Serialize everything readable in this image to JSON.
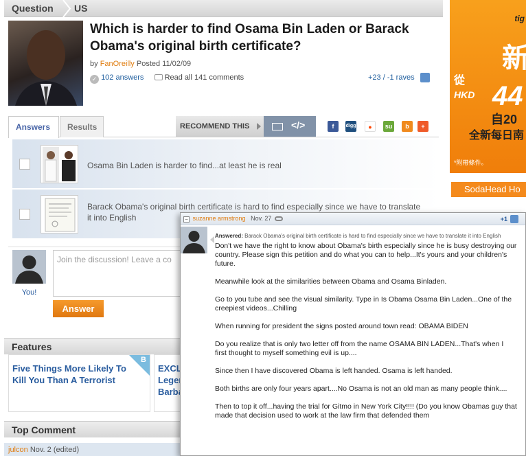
{
  "breadcrumb": {
    "section": "Question",
    "category": "US"
  },
  "question": {
    "title": "Which is harder to find Osama Bin Laden or Barack Obama's original birth certificate?",
    "by_label": "by",
    "author": "FanOreilly",
    "posted": "Posted 11/02/09",
    "answers_count": "102 answers",
    "read_all": "Read all 141 comments",
    "raves": "+23 / -1 raves"
  },
  "tabs": [
    {
      "label": "Answers",
      "active": true
    },
    {
      "label": "Results",
      "active": false
    }
  ],
  "recommend": {
    "label": "RECOMMEND THIS",
    "icons": [
      "facebook-icon",
      "digg-icon",
      "reddit-icon",
      "stumbleupon-icon",
      "blogger-icon",
      "plus-icon"
    ]
  },
  "answers": [
    {
      "text": "Osama Bin Laden is harder to find...at least he is real"
    },
    {
      "text": "Barack Obama's original birth certificate is hard to find especially since we have to translate it into English"
    }
  ],
  "discussion": {
    "placeholder": "Join the discussion! Leave a co",
    "you_label": "You!",
    "answer_button": "Answer"
  },
  "features": {
    "heading": "Features",
    "items": [
      {
        "title": "Five Things More Likely To Kill You Than A Terrorist",
        "badge": "B"
      },
      {
        "title": "EXCL Leger Barba"
      }
    ]
  },
  "top_comment": {
    "heading": "Top Comment",
    "user": "julcon",
    "date": "Nov. 2 (edited)"
  },
  "ad": {
    "brand": "tig",
    "big_char": "新",
    "line1": "從",
    "hkd": "HKD",
    "price": "44",
    "line2": "自20",
    "line3": "全新每日南",
    "footnote": "*附帶條件。"
  },
  "sidebar": {
    "sodahead_label": "SodaHead Ho"
  },
  "popup": {
    "user": "suzanne armstrong",
    "date": "Nov. 27",
    "plus": "+1",
    "answered_label": "Answered:",
    "answered_text": "Barack Obama's original birth certificate is hard to find especially since we have to translate it into English",
    "paragraphs": [
      "Don't we have the right to know about Obama's birth especially since he is busy destroying our country. Please sign this petition and do what you can to help...It's yours and your children's future.",
      "Meanwhile look at the similarities between Obama and Osama Binladen.",
      "Go to you tube and see the visual similarity. Type in Is Obama Osama Bin Laden...One of the creepiest videos...Chilling",
      "When running for president the signs posted around town read: OBAMA BIDEN",
      "Do you realize that is only two letter off from the name OSAMA BIN LADEN...That's when I first thought to myself something evil is up....",
      "Since then I have discovered Obama is left handed. Osama is left handed.",
      "Both births are only four years apart....No Osama is not an old man as many people think....",
      "Then to top it off...having the trial for Gitmo in New York City!!!! (Do you know Obamas guy that made that decision used to work at the law firm that defended them"
    ]
  },
  "colors": {
    "accent_orange": "#e07d10",
    "link_blue": "#1f5e9e",
    "tab_blue": "#4a66a8"
  }
}
